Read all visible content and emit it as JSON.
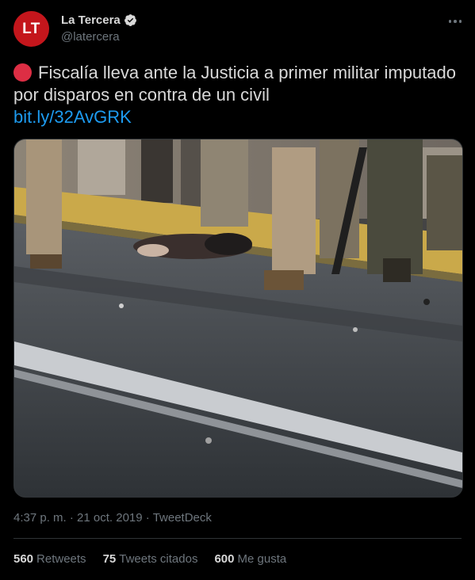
{
  "author": {
    "avatar_text": "LT",
    "name": "La Tercera",
    "handle": "@latercera",
    "avatar_color": "#c4161c"
  },
  "tweet": {
    "text": "Fiscalía lleva ante la Justicia a primer militar imputado por disparos en contra de un civil",
    "link": "bit.ly/32AvGRK",
    "emoji": "red-circle-icon"
  },
  "meta": {
    "time": "4:37 p. m.",
    "separator1": "·",
    "date": "21 oct. 2019",
    "separator2": "·",
    "source": "TweetDeck"
  },
  "stats": {
    "retweets_count": "560",
    "retweets_label": "Retweets",
    "quotes_count": "75",
    "quotes_label": "Tweets citados",
    "likes_count": "600",
    "likes_label": "Me gusta"
  },
  "colors": {
    "background": "#000000",
    "link": "#1d9bf0",
    "muted": "#6e767d",
    "text": "#d9d9d9",
    "verified": "#d9d9d9"
  }
}
